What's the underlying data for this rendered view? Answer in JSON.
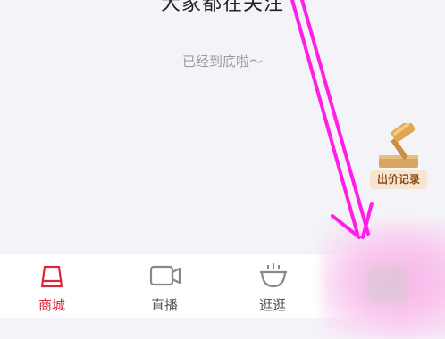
{
  "section": {
    "title": "大家都在关注"
  },
  "list": {
    "end_text": "已经到底啦～"
  },
  "bid_badge": {
    "label": "出价记录",
    "icon": "gavel-icon"
  },
  "nav": {
    "items": [
      {
        "label": "商城",
        "icon": "store-bag-icon",
        "active": true
      },
      {
        "label": "直播",
        "icon": "video-camera-icon",
        "active": false
      },
      {
        "label": "逛逛",
        "icon": "bowl-icon",
        "active": false
      }
    ]
  },
  "colors": {
    "accent": "#e0243a",
    "background": "#f4f4f8",
    "annotation": "#ff1ee6"
  }
}
